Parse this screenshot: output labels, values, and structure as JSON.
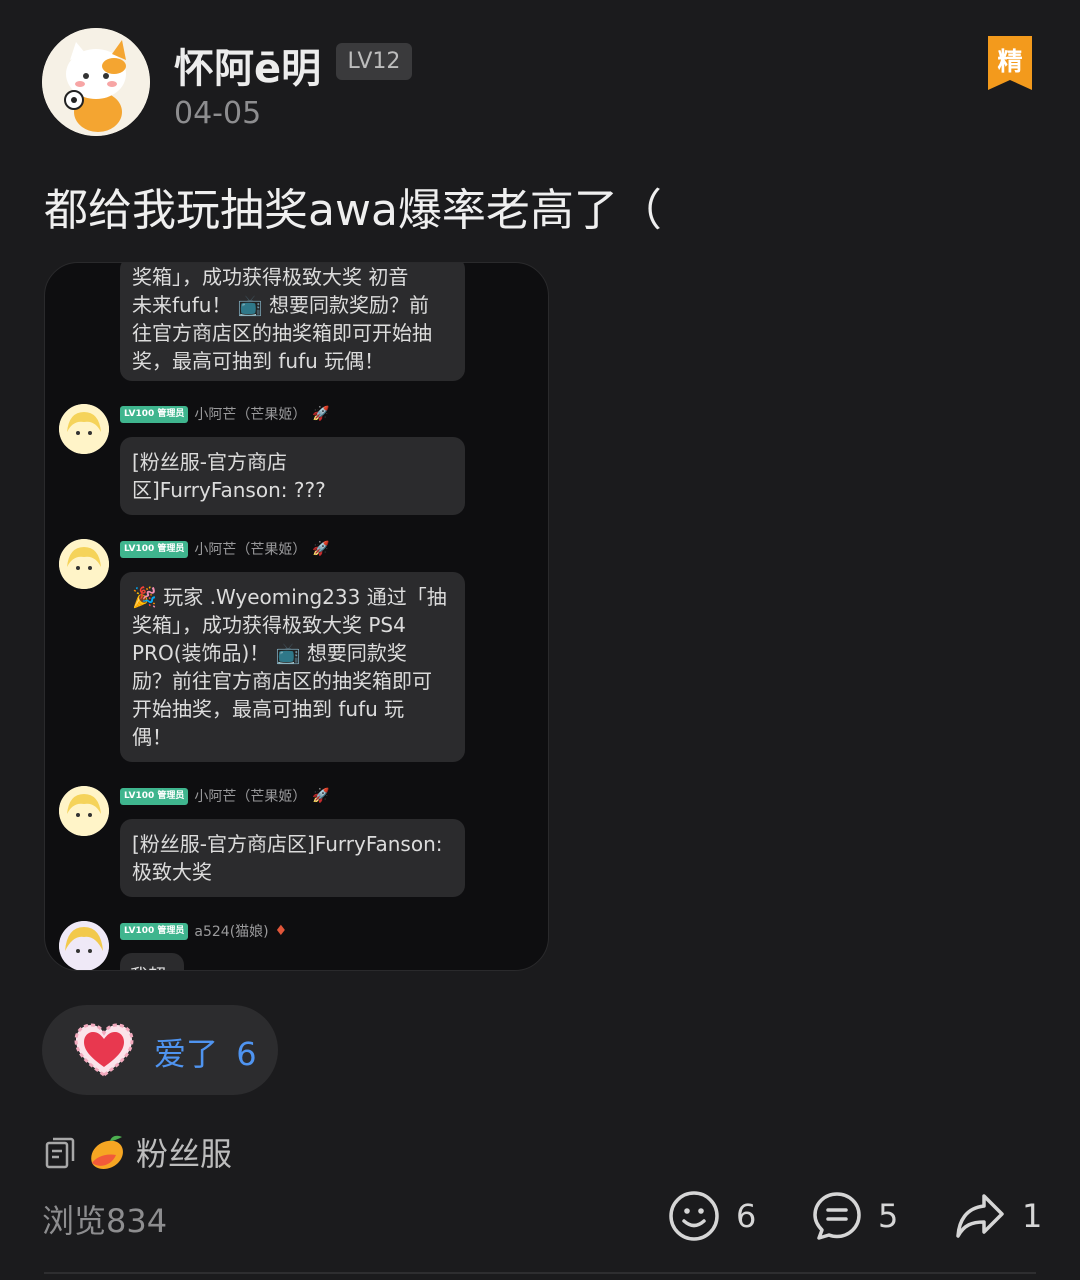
{
  "author": {
    "name": "怀阿ē明",
    "level": "LV12",
    "date": "04-05"
  },
  "featured_label": "精",
  "post_text": "都给我玩抽奖awa爆率老高了（",
  "screenshot": {
    "top_bubble": [
      "奖箱」，成功获得极致大奖 初音",
      "未来fufu！ 📺 想要同款奖励？前",
      "往官方商店区的抽奖箱即可开始抽",
      "奖，最高可抽到 fufu 玩偶！"
    ],
    "messages": [
      {
        "tag": "LV100 管理员",
        "sender": "小阿芒（芒果姬）",
        "lines": [
          "[粉丝服-官方商店",
          "区]FurryFanson: ???"
        ]
      },
      {
        "tag": "LV100 管理员",
        "sender": "小阿芒（芒果姬）",
        "lines": [
          "🎉 玩家 .Wyeoming233 通过「抽",
          "奖箱」，成功获得极致大奖 PS4",
          "PRO(装饰品)！ 📺 想要同款奖",
          "励？前往官方商店区的抽奖箱即可",
          "开始抽奖，最高可抽到 fufu 玩",
          "偶！"
        ]
      },
      {
        "tag": "LV100 管理员",
        "sender": "小阿芒（芒果姬）",
        "lines": [
          "[粉丝服-官方商店区]FurryFanson:",
          "极致大奖"
        ]
      },
      {
        "tag": "LV100 管理员",
        "sender": "a524(猫娘)",
        "lines": [
          "我超"
        ]
      }
    ]
  },
  "reaction": {
    "label": "爱了",
    "count": "6"
  },
  "circle": {
    "name": "粉丝服"
  },
  "footer": {
    "views": "浏览834",
    "emoji_count": "6",
    "comment_count": "5",
    "share_count": "1"
  },
  "colors": {
    "background": "#1b1b1d",
    "accent_blue": "#4f94f0",
    "featured_orange": "#f39a1c",
    "admin_green": "#3fb58e"
  }
}
